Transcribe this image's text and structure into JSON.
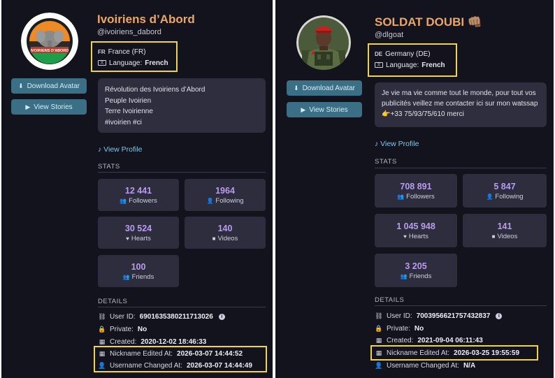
{
  "panels": [
    {
      "display_name": "Ivoiriens d’Abord",
      "handle": "@ivoiriens_dabord",
      "avatar_text": "IVOIRIENS D'ABORD",
      "country_code": "FR",
      "country": "France (FR)",
      "language_label": "Language:",
      "language": "French",
      "download_avatar": "Download Avatar",
      "view_stories": "View Stories",
      "bio_lines": [
        "Révolution des Ivoiriens d’Abord",
        "Peuple Ivoirien",
        "Terre Ivoirienne",
        "#ivoirien #ci"
      ],
      "view_profile": "View Profile",
      "stats_title": "STATS",
      "stats": [
        {
          "value": "12 441",
          "label": "Followers",
          "icon": "followers-icon"
        },
        {
          "value": "1964",
          "label": "Following",
          "icon": "following-icon"
        },
        {
          "value": "30 524",
          "label": "Hearts",
          "icon": "heart-icon"
        },
        {
          "value": "140",
          "label": "Videos",
          "icon": "video-icon"
        },
        {
          "value": "100",
          "label": "Friends",
          "icon": "friends-icon"
        }
      ],
      "details_title": "DETAILS",
      "details": [
        {
          "label": "User ID:",
          "value": "6901635380211713026",
          "icon": "fingerprint-icon",
          "info": true
        },
        {
          "label": "Private:",
          "value": "No",
          "icon": "lock-icon"
        },
        {
          "label": "Created:",
          "value": "2020-12-02 18:46:33",
          "icon": "calendar-icon"
        },
        {
          "label": "Nickname Edited At:",
          "value": "2026-03-07 14:44:52",
          "icon": "calendar-edit-icon"
        },
        {
          "label": "Username Changed At:",
          "value": "2026-03-07 14:44:49",
          "icon": "user-edit-icon"
        }
      ]
    },
    {
      "display_name": "SOLDAT DOUBI 👊🏽",
      "handle": "@dlgoat",
      "country_code": "DE",
      "country": "Germany (DE)",
      "language_label": "Language:",
      "language": "French",
      "download_avatar": "Download Avatar",
      "view_stories": "View Stories",
      "bio_lines": [
        "Je vie ma vie comme tout le monde, pour tout vos publicités veillez me contacter ici sur mon watssap 👉+33 75/93/75/610 merci"
      ],
      "view_profile": "View Profile",
      "stats_title": "STATS",
      "stats": [
        {
          "value": "708 891",
          "label": "Followers",
          "icon": "followers-icon"
        },
        {
          "value": "5 847",
          "label": "Following",
          "icon": "following-icon"
        },
        {
          "value": "1 045 948",
          "label": "Hearts",
          "icon": "heart-icon"
        },
        {
          "value": "141",
          "label": "Videos",
          "icon": "video-icon"
        },
        {
          "value": "3 205",
          "label": "Friends",
          "icon": "friends-icon"
        }
      ],
      "details_title": "DETAILS",
      "details": [
        {
          "label": "User ID:",
          "value": "7003956621757432837",
          "icon": "fingerprint-icon",
          "info": true
        },
        {
          "label": "Private:",
          "value": "No",
          "icon": "lock-icon"
        },
        {
          "label": "Created:",
          "value": "2021-09-04 06:11:43",
          "icon": "calendar-icon"
        },
        {
          "label": "Nickname Edited At:",
          "value": "2026-03-25 19:55:59",
          "icon": "calendar-edit-icon"
        },
        {
          "label": "Username Changed At:",
          "value": "N/A",
          "icon": "user-edit-icon"
        }
      ]
    }
  ],
  "colors": {
    "background": "#13131d",
    "card": "#2d2d3d",
    "accent_name": "#e9a86a",
    "stat_value": "#b99cef",
    "button": "#3b6f86",
    "link": "#86c6e8",
    "highlight": "#f0d34a"
  }
}
